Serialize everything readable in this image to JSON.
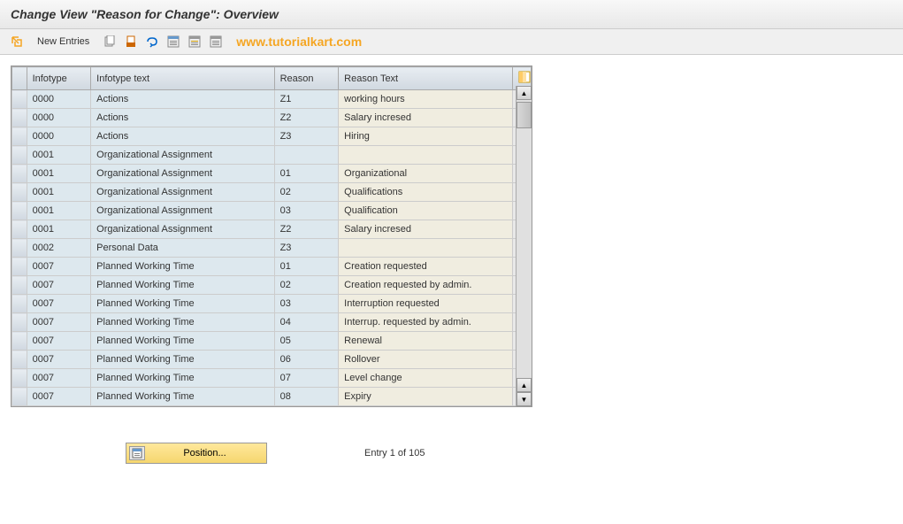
{
  "title": "Change View \"Reason for Change\": Overview",
  "toolbar": {
    "new_entries_label": "New Entries"
  },
  "watermark": "www.tutorialkart.com",
  "table": {
    "headers": {
      "infotype": "Infotype",
      "infotype_text": "Infotype text",
      "reason": "Reason",
      "reason_text": "Reason Text"
    },
    "rows": [
      {
        "infotype": "0000",
        "infotype_text": "Actions",
        "reason": "Z1",
        "reason_text": "working hours"
      },
      {
        "infotype": "0000",
        "infotype_text": "Actions",
        "reason": "Z2",
        "reason_text": "Salary incresed"
      },
      {
        "infotype": "0000",
        "infotype_text": "Actions",
        "reason": "Z3",
        "reason_text": "Hiring"
      },
      {
        "infotype": "0001",
        "infotype_text": "Organizational Assignment",
        "reason": "",
        "reason_text": ""
      },
      {
        "infotype": "0001",
        "infotype_text": "Organizational Assignment",
        "reason": "01",
        "reason_text": "Organizational"
      },
      {
        "infotype": "0001",
        "infotype_text": "Organizational Assignment",
        "reason": "02",
        "reason_text": "Qualifications"
      },
      {
        "infotype": "0001",
        "infotype_text": "Organizational Assignment",
        "reason": "03",
        "reason_text": "Qualification"
      },
      {
        "infotype": "0001",
        "infotype_text": "Organizational Assignment",
        "reason": "Z2",
        "reason_text": "Salary incresed"
      },
      {
        "infotype": "0002",
        "infotype_text": "Personal Data",
        "reason": "Z3",
        "reason_text": ""
      },
      {
        "infotype": "0007",
        "infotype_text": "Planned Working Time",
        "reason": "01",
        "reason_text": "Creation requested"
      },
      {
        "infotype": "0007",
        "infotype_text": "Planned Working Time",
        "reason": "02",
        "reason_text": "Creation requested by admin."
      },
      {
        "infotype": "0007",
        "infotype_text": "Planned Working Time",
        "reason": "03",
        "reason_text": "Interruption requested"
      },
      {
        "infotype": "0007",
        "infotype_text": "Planned Working Time",
        "reason": "04",
        "reason_text": "Interrup. requested by admin."
      },
      {
        "infotype": "0007",
        "infotype_text": "Planned Working Time",
        "reason": "05",
        "reason_text": "Renewal"
      },
      {
        "infotype": "0007",
        "infotype_text": "Planned Working Time",
        "reason": "06",
        "reason_text": "Rollover"
      },
      {
        "infotype": "0007",
        "infotype_text": "Planned Working Time",
        "reason": "07",
        "reason_text": "Level change"
      },
      {
        "infotype": "0007",
        "infotype_text": "Planned Working Time",
        "reason": "08",
        "reason_text": "Expiry"
      }
    ]
  },
  "footer": {
    "position_label": "Position...",
    "entry_count": "Entry 1 of 105"
  }
}
